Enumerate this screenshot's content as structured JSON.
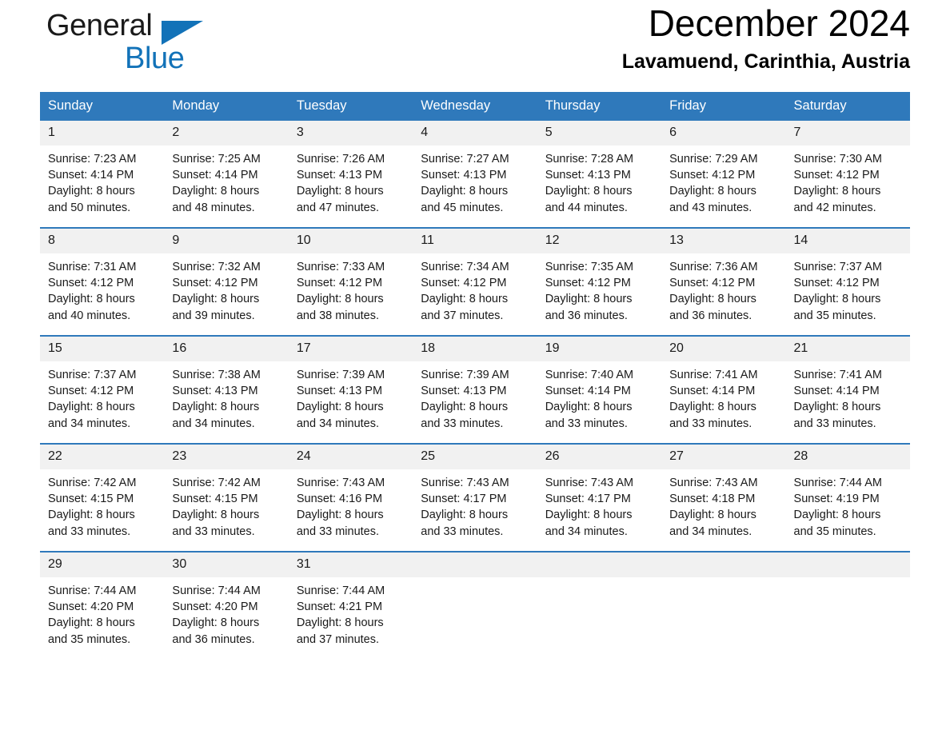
{
  "brand": {
    "name_part1": "General",
    "name_part2": "Blue",
    "flag_icon": "triangle-flag-icon"
  },
  "header": {
    "month_title": "December 2024",
    "location": "Lavamuend, Carinthia, Austria"
  },
  "theme": {
    "header_blue": "#2f79bb",
    "brand_blue": "#1272b8",
    "daynum_band": "#f1f1f1",
    "text": "#1a1a1a"
  },
  "weekday_headers": [
    "Sunday",
    "Monday",
    "Tuesday",
    "Wednesday",
    "Thursday",
    "Friday",
    "Saturday"
  ],
  "weeks": [
    [
      {
        "day": "1",
        "sunrise": "Sunrise: 7:23 AM",
        "sunset": "Sunset: 4:14 PM",
        "daylight_line1": "Daylight: 8 hours",
        "daylight_line2": "and 50 minutes."
      },
      {
        "day": "2",
        "sunrise": "Sunrise: 7:25 AM",
        "sunset": "Sunset: 4:14 PM",
        "daylight_line1": "Daylight: 8 hours",
        "daylight_line2": "and 48 minutes."
      },
      {
        "day": "3",
        "sunrise": "Sunrise: 7:26 AM",
        "sunset": "Sunset: 4:13 PM",
        "daylight_line1": "Daylight: 8 hours",
        "daylight_line2": "and 47 minutes."
      },
      {
        "day": "4",
        "sunrise": "Sunrise: 7:27 AM",
        "sunset": "Sunset: 4:13 PM",
        "daylight_line1": "Daylight: 8 hours",
        "daylight_line2": "and 45 minutes."
      },
      {
        "day": "5",
        "sunrise": "Sunrise: 7:28 AM",
        "sunset": "Sunset: 4:13 PM",
        "daylight_line1": "Daylight: 8 hours",
        "daylight_line2": "and 44 minutes."
      },
      {
        "day": "6",
        "sunrise": "Sunrise: 7:29 AM",
        "sunset": "Sunset: 4:12 PM",
        "daylight_line1": "Daylight: 8 hours",
        "daylight_line2": "and 43 minutes."
      },
      {
        "day": "7",
        "sunrise": "Sunrise: 7:30 AM",
        "sunset": "Sunset: 4:12 PM",
        "daylight_line1": "Daylight: 8 hours",
        "daylight_line2": "and 42 minutes."
      }
    ],
    [
      {
        "day": "8",
        "sunrise": "Sunrise: 7:31 AM",
        "sunset": "Sunset: 4:12 PM",
        "daylight_line1": "Daylight: 8 hours",
        "daylight_line2": "and 40 minutes."
      },
      {
        "day": "9",
        "sunrise": "Sunrise: 7:32 AM",
        "sunset": "Sunset: 4:12 PM",
        "daylight_line1": "Daylight: 8 hours",
        "daylight_line2": "and 39 minutes."
      },
      {
        "day": "10",
        "sunrise": "Sunrise: 7:33 AM",
        "sunset": "Sunset: 4:12 PM",
        "daylight_line1": "Daylight: 8 hours",
        "daylight_line2": "and 38 minutes."
      },
      {
        "day": "11",
        "sunrise": "Sunrise: 7:34 AM",
        "sunset": "Sunset: 4:12 PM",
        "daylight_line1": "Daylight: 8 hours",
        "daylight_line2": "and 37 minutes."
      },
      {
        "day": "12",
        "sunrise": "Sunrise: 7:35 AM",
        "sunset": "Sunset: 4:12 PM",
        "daylight_line1": "Daylight: 8 hours",
        "daylight_line2": "and 36 minutes."
      },
      {
        "day": "13",
        "sunrise": "Sunrise: 7:36 AM",
        "sunset": "Sunset: 4:12 PM",
        "daylight_line1": "Daylight: 8 hours",
        "daylight_line2": "and 36 minutes."
      },
      {
        "day": "14",
        "sunrise": "Sunrise: 7:37 AM",
        "sunset": "Sunset: 4:12 PM",
        "daylight_line1": "Daylight: 8 hours",
        "daylight_line2": "and 35 minutes."
      }
    ],
    [
      {
        "day": "15",
        "sunrise": "Sunrise: 7:37 AM",
        "sunset": "Sunset: 4:12 PM",
        "daylight_line1": "Daylight: 8 hours",
        "daylight_line2": "and 34 minutes."
      },
      {
        "day": "16",
        "sunrise": "Sunrise: 7:38 AM",
        "sunset": "Sunset: 4:13 PM",
        "daylight_line1": "Daylight: 8 hours",
        "daylight_line2": "and 34 minutes."
      },
      {
        "day": "17",
        "sunrise": "Sunrise: 7:39 AM",
        "sunset": "Sunset: 4:13 PM",
        "daylight_line1": "Daylight: 8 hours",
        "daylight_line2": "and 34 minutes."
      },
      {
        "day": "18",
        "sunrise": "Sunrise: 7:39 AM",
        "sunset": "Sunset: 4:13 PM",
        "daylight_line1": "Daylight: 8 hours",
        "daylight_line2": "and 33 minutes."
      },
      {
        "day": "19",
        "sunrise": "Sunrise: 7:40 AM",
        "sunset": "Sunset: 4:14 PM",
        "daylight_line1": "Daylight: 8 hours",
        "daylight_line2": "and 33 minutes."
      },
      {
        "day": "20",
        "sunrise": "Sunrise: 7:41 AM",
        "sunset": "Sunset: 4:14 PM",
        "daylight_line1": "Daylight: 8 hours",
        "daylight_line2": "and 33 minutes."
      },
      {
        "day": "21",
        "sunrise": "Sunrise: 7:41 AM",
        "sunset": "Sunset: 4:14 PM",
        "daylight_line1": "Daylight: 8 hours",
        "daylight_line2": "and 33 minutes."
      }
    ],
    [
      {
        "day": "22",
        "sunrise": "Sunrise: 7:42 AM",
        "sunset": "Sunset: 4:15 PM",
        "daylight_line1": "Daylight: 8 hours",
        "daylight_line2": "and 33 minutes."
      },
      {
        "day": "23",
        "sunrise": "Sunrise: 7:42 AM",
        "sunset": "Sunset: 4:15 PM",
        "daylight_line1": "Daylight: 8 hours",
        "daylight_line2": "and 33 minutes."
      },
      {
        "day": "24",
        "sunrise": "Sunrise: 7:43 AM",
        "sunset": "Sunset: 4:16 PM",
        "daylight_line1": "Daylight: 8 hours",
        "daylight_line2": "and 33 minutes."
      },
      {
        "day": "25",
        "sunrise": "Sunrise: 7:43 AM",
        "sunset": "Sunset: 4:17 PM",
        "daylight_line1": "Daylight: 8 hours",
        "daylight_line2": "and 33 minutes."
      },
      {
        "day": "26",
        "sunrise": "Sunrise: 7:43 AM",
        "sunset": "Sunset: 4:17 PM",
        "daylight_line1": "Daylight: 8 hours",
        "daylight_line2": "and 34 minutes."
      },
      {
        "day": "27",
        "sunrise": "Sunrise: 7:43 AM",
        "sunset": "Sunset: 4:18 PM",
        "daylight_line1": "Daylight: 8 hours",
        "daylight_line2": "and 34 minutes."
      },
      {
        "day": "28",
        "sunrise": "Sunrise: 7:44 AM",
        "sunset": "Sunset: 4:19 PM",
        "daylight_line1": "Daylight: 8 hours",
        "daylight_line2": "and 35 minutes."
      }
    ],
    [
      {
        "day": "29",
        "sunrise": "Sunrise: 7:44 AM",
        "sunset": "Sunset: 4:20 PM",
        "daylight_line1": "Daylight: 8 hours",
        "daylight_line2": "and 35 minutes."
      },
      {
        "day": "30",
        "sunrise": "Sunrise: 7:44 AM",
        "sunset": "Sunset: 4:20 PM",
        "daylight_line1": "Daylight: 8 hours",
        "daylight_line2": "and 36 minutes."
      },
      {
        "day": "31",
        "sunrise": "Sunrise: 7:44 AM",
        "sunset": "Sunset: 4:21 PM",
        "daylight_line1": "Daylight: 8 hours",
        "daylight_line2": "and 37 minutes."
      },
      {
        "day": "",
        "sunrise": "",
        "sunset": "",
        "daylight_line1": "",
        "daylight_line2": ""
      },
      {
        "day": "",
        "sunrise": "",
        "sunset": "",
        "daylight_line1": "",
        "daylight_line2": ""
      },
      {
        "day": "",
        "sunrise": "",
        "sunset": "",
        "daylight_line1": "",
        "daylight_line2": ""
      },
      {
        "day": "",
        "sunrise": "",
        "sunset": "",
        "daylight_line1": "",
        "daylight_line2": ""
      }
    ]
  ]
}
